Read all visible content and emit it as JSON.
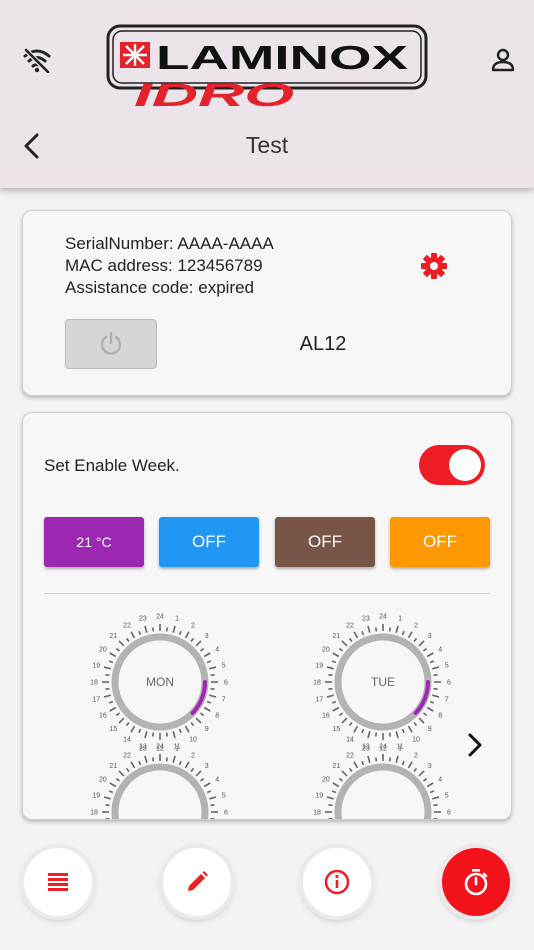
{
  "header": {
    "title": "Test",
    "logo_top": "LAMINOX",
    "logo_bottom": "IDRO"
  },
  "device": {
    "serial_line": "SerialNumber: AAAA-AAAA",
    "mac_line": "MAC address: 123456789",
    "assistance_line": "Assistance code: expired",
    "model": "AL12"
  },
  "schedule": {
    "enable_label": "Set Enable Week.",
    "enabled": true,
    "chips": [
      {
        "label": "21 °C",
        "color": "#9c27b0"
      },
      {
        "label": "OFF",
        "color": "#2196f3"
      },
      {
        "label": "OFF",
        "color": "#795548"
      },
      {
        "label": "OFF",
        "color": "#ff9800"
      }
    ],
    "days": [
      {
        "label": "MON"
      },
      {
        "label": "TUE"
      }
    ],
    "hour_ticks": [
      "24",
      "1",
      "2",
      "3",
      "4",
      "5",
      "6",
      "7",
      "8",
      "9",
      "10",
      "11",
      "12",
      "13",
      "14",
      "15",
      "16",
      "17",
      "18",
      "19",
      "20",
      "21",
      "22",
      "23"
    ]
  },
  "colors": {
    "brand_red": "#ef1d24",
    "purple": "#9c27b0",
    "header_bg": "#ebe4ea"
  },
  "icons": {
    "wifi": "wifi-off-icon",
    "user": "user-icon",
    "back": "chevron-left-icon",
    "settings": "gear-icon",
    "power": "power-icon",
    "next": "chevron-right-icon",
    "fab1": "list-icon",
    "fab2": "pencil-icon",
    "fab3": "info-icon",
    "fab4": "timer-icon"
  }
}
